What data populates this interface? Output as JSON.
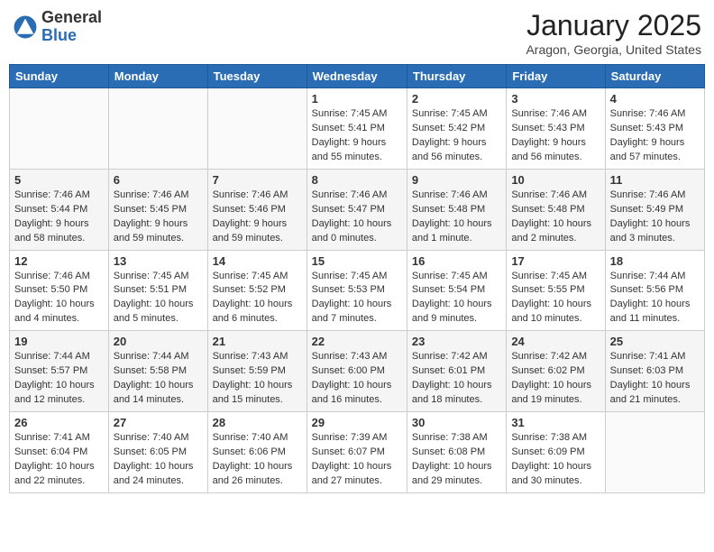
{
  "header": {
    "logo_general": "General",
    "logo_blue": "Blue",
    "month_title": "January 2025",
    "subtitle": "Aragon, Georgia, United States"
  },
  "weekdays": [
    "Sunday",
    "Monday",
    "Tuesday",
    "Wednesday",
    "Thursday",
    "Friday",
    "Saturday"
  ],
  "weeks": [
    [
      {
        "day": "",
        "info": ""
      },
      {
        "day": "",
        "info": ""
      },
      {
        "day": "",
        "info": ""
      },
      {
        "day": "1",
        "info": "Sunrise: 7:45 AM\nSunset: 5:41 PM\nDaylight: 9 hours and 55 minutes."
      },
      {
        "day": "2",
        "info": "Sunrise: 7:45 AM\nSunset: 5:42 PM\nDaylight: 9 hours and 56 minutes."
      },
      {
        "day": "3",
        "info": "Sunrise: 7:46 AM\nSunset: 5:43 PM\nDaylight: 9 hours and 56 minutes."
      },
      {
        "day": "4",
        "info": "Sunrise: 7:46 AM\nSunset: 5:43 PM\nDaylight: 9 hours and 57 minutes."
      }
    ],
    [
      {
        "day": "5",
        "info": "Sunrise: 7:46 AM\nSunset: 5:44 PM\nDaylight: 9 hours and 58 minutes."
      },
      {
        "day": "6",
        "info": "Sunrise: 7:46 AM\nSunset: 5:45 PM\nDaylight: 9 hours and 59 minutes."
      },
      {
        "day": "7",
        "info": "Sunrise: 7:46 AM\nSunset: 5:46 PM\nDaylight: 9 hours and 59 minutes."
      },
      {
        "day": "8",
        "info": "Sunrise: 7:46 AM\nSunset: 5:47 PM\nDaylight: 10 hours and 0 minutes."
      },
      {
        "day": "9",
        "info": "Sunrise: 7:46 AM\nSunset: 5:48 PM\nDaylight: 10 hours and 1 minute."
      },
      {
        "day": "10",
        "info": "Sunrise: 7:46 AM\nSunset: 5:48 PM\nDaylight: 10 hours and 2 minutes."
      },
      {
        "day": "11",
        "info": "Sunrise: 7:46 AM\nSunset: 5:49 PM\nDaylight: 10 hours and 3 minutes."
      }
    ],
    [
      {
        "day": "12",
        "info": "Sunrise: 7:46 AM\nSunset: 5:50 PM\nDaylight: 10 hours and 4 minutes."
      },
      {
        "day": "13",
        "info": "Sunrise: 7:45 AM\nSunset: 5:51 PM\nDaylight: 10 hours and 5 minutes."
      },
      {
        "day": "14",
        "info": "Sunrise: 7:45 AM\nSunset: 5:52 PM\nDaylight: 10 hours and 6 minutes."
      },
      {
        "day": "15",
        "info": "Sunrise: 7:45 AM\nSunset: 5:53 PM\nDaylight: 10 hours and 7 minutes."
      },
      {
        "day": "16",
        "info": "Sunrise: 7:45 AM\nSunset: 5:54 PM\nDaylight: 10 hours and 9 minutes."
      },
      {
        "day": "17",
        "info": "Sunrise: 7:45 AM\nSunset: 5:55 PM\nDaylight: 10 hours and 10 minutes."
      },
      {
        "day": "18",
        "info": "Sunrise: 7:44 AM\nSunset: 5:56 PM\nDaylight: 10 hours and 11 minutes."
      }
    ],
    [
      {
        "day": "19",
        "info": "Sunrise: 7:44 AM\nSunset: 5:57 PM\nDaylight: 10 hours and 12 minutes."
      },
      {
        "day": "20",
        "info": "Sunrise: 7:44 AM\nSunset: 5:58 PM\nDaylight: 10 hours and 14 minutes."
      },
      {
        "day": "21",
        "info": "Sunrise: 7:43 AM\nSunset: 5:59 PM\nDaylight: 10 hours and 15 minutes."
      },
      {
        "day": "22",
        "info": "Sunrise: 7:43 AM\nSunset: 6:00 PM\nDaylight: 10 hours and 16 minutes."
      },
      {
        "day": "23",
        "info": "Sunrise: 7:42 AM\nSunset: 6:01 PM\nDaylight: 10 hours and 18 minutes."
      },
      {
        "day": "24",
        "info": "Sunrise: 7:42 AM\nSunset: 6:02 PM\nDaylight: 10 hours and 19 minutes."
      },
      {
        "day": "25",
        "info": "Sunrise: 7:41 AM\nSunset: 6:03 PM\nDaylight: 10 hours and 21 minutes."
      }
    ],
    [
      {
        "day": "26",
        "info": "Sunrise: 7:41 AM\nSunset: 6:04 PM\nDaylight: 10 hours and 22 minutes."
      },
      {
        "day": "27",
        "info": "Sunrise: 7:40 AM\nSunset: 6:05 PM\nDaylight: 10 hours and 24 minutes."
      },
      {
        "day": "28",
        "info": "Sunrise: 7:40 AM\nSunset: 6:06 PM\nDaylight: 10 hours and 26 minutes."
      },
      {
        "day": "29",
        "info": "Sunrise: 7:39 AM\nSunset: 6:07 PM\nDaylight: 10 hours and 27 minutes."
      },
      {
        "day": "30",
        "info": "Sunrise: 7:38 AM\nSunset: 6:08 PM\nDaylight: 10 hours and 29 minutes."
      },
      {
        "day": "31",
        "info": "Sunrise: 7:38 AM\nSunset: 6:09 PM\nDaylight: 10 hours and 30 minutes."
      },
      {
        "day": "",
        "info": ""
      }
    ]
  ]
}
